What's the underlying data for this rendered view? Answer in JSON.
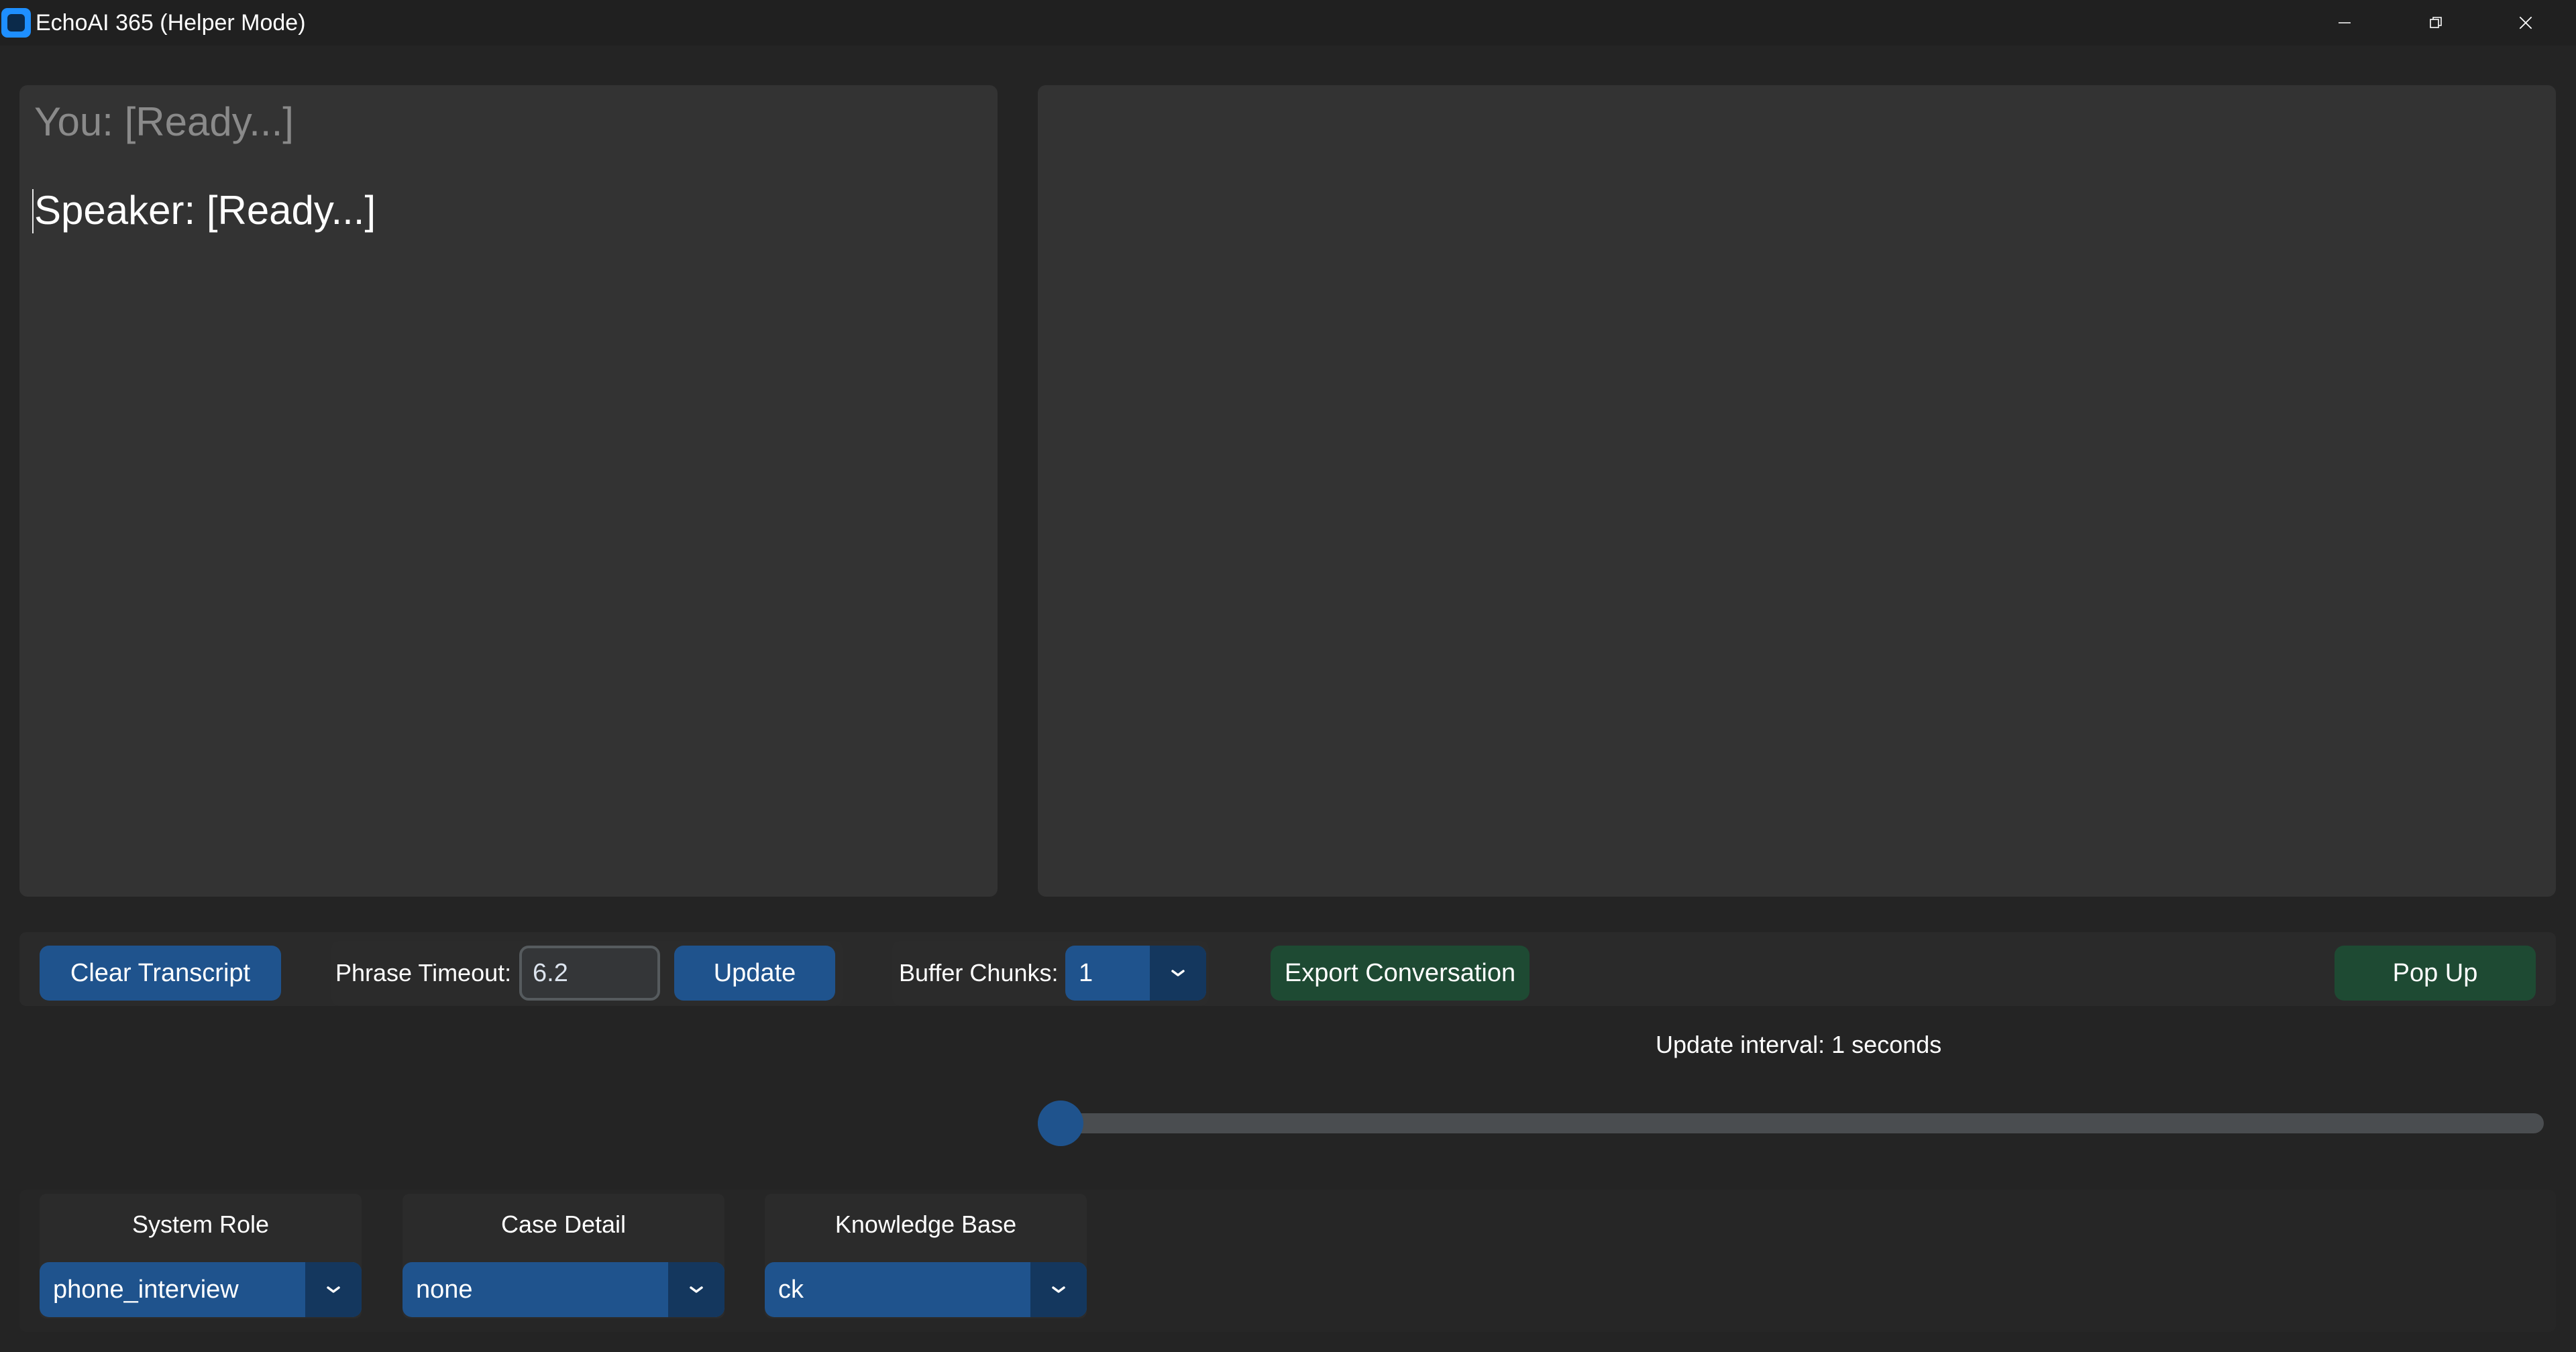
{
  "window": {
    "title": "EchoAI 365 (Helper Mode)",
    "icon": "app-icon",
    "controls": [
      "minimize-icon",
      "restore-icon",
      "close-icon"
    ]
  },
  "transcript": {
    "you_line": "You: [Ready...]",
    "speaker_line": "Speaker: [Ready...]"
  },
  "response_panel": {
    "text": ""
  },
  "controls": {
    "clear_label": "Clear Transcript",
    "phrase_timeout_label": "Phrase Timeout:",
    "phrase_timeout_value": "6.2",
    "update_label": "Update",
    "buffer_chunks_label": "Buffer Chunks:",
    "buffer_chunks_value": "1",
    "export_label": "Export Conversation",
    "popup_label": "Pop Up"
  },
  "update_interval": {
    "label": "Update interval: 1 seconds",
    "slider_fraction": 0.0
  },
  "selectors": [
    {
      "title": "System Role",
      "value": "phone_interview"
    },
    {
      "title": "Case Detail",
      "value": "none"
    },
    {
      "title": "Knowledge Base",
      "value": "ck"
    }
  ],
  "colors": {
    "background": "#242424",
    "panel": "#333333",
    "accent_blue": "#1f538d",
    "accent_green": "#1e4a33",
    "muted_text": "#8a8a8a"
  }
}
